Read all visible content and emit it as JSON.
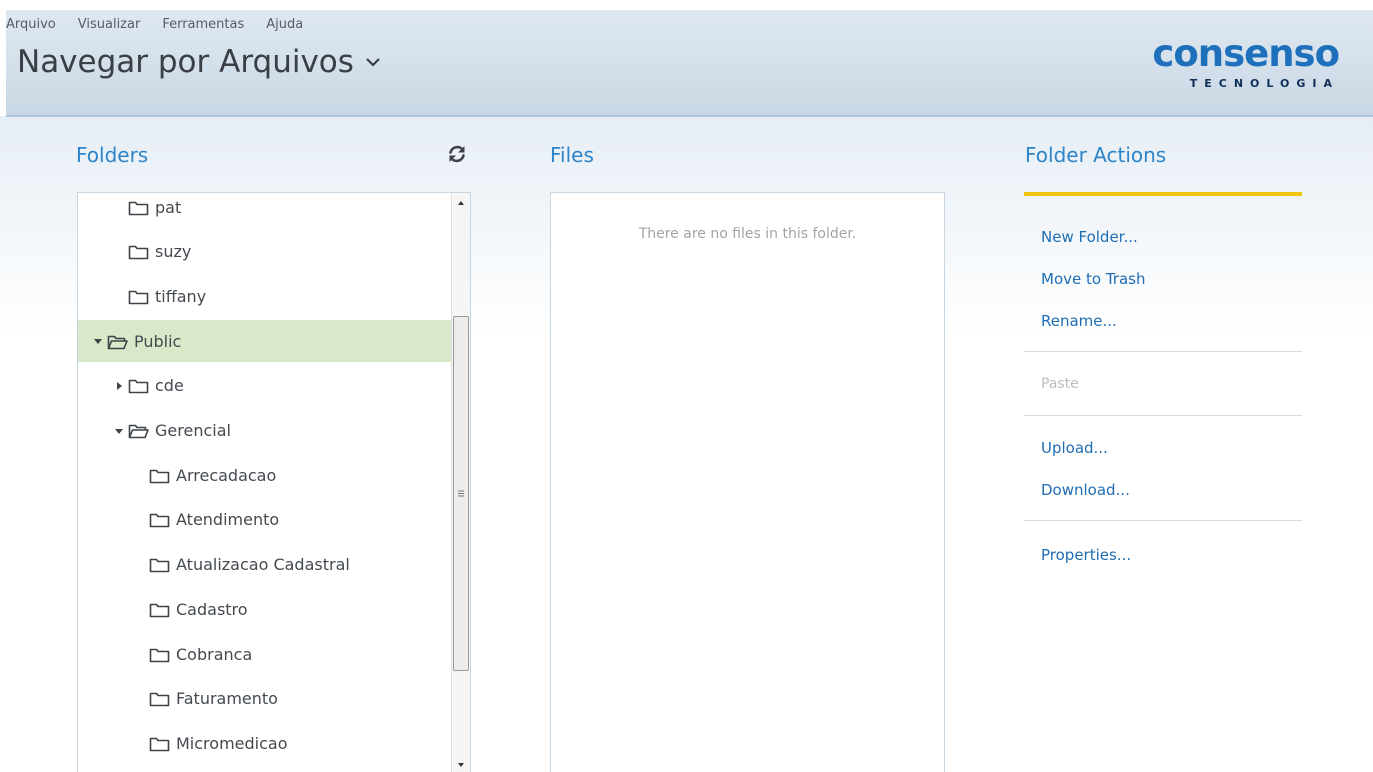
{
  "menu": [
    "Arquivo",
    "Visualizar",
    "Ferramentas",
    "Ajuda"
  ],
  "app_title": "Navegar por Arquivos",
  "logo": {
    "word": "consenso",
    "sub": "TECNOLOGIA",
    "color": "#1e70bd"
  },
  "folders": {
    "title": "Folders",
    "refresh_icon": "refresh-icon",
    "items": [
      {
        "label": "pat",
        "state": "leaf",
        "depth": 1
      },
      {
        "label": "suzy",
        "state": "leaf",
        "depth": 1
      },
      {
        "label": "tiffany",
        "state": "leaf",
        "depth": 1
      },
      {
        "label": "Public",
        "state": "expanded",
        "depth": 0,
        "selected": true
      },
      {
        "label": "cde",
        "state": "collapsed",
        "depth": 1
      },
      {
        "label": "Gerencial",
        "state": "expanded",
        "depth": 1
      },
      {
        "label": "Arrecadacao",
        "state": "leaf",
        "depth": 2
      },
      {
        "label": "Atendimento",
        "state": "leaf",
        "depth": 2
      },
      {
        "label": "Atualizacao Cadastral",
        "state": "leaf",
        "depth": 2
      },
      {
        "label": "Cadastro",
        "state": "leaf",
        "depth": 2
      },
      {
        "label": "Cobranca",
        "state": "leaf",
        "depth": 2
      },
      {
        "label": "Faturamento",
        "state": "leaf",
        "depth": 2
      },
      {
        "label": "Micromedicao",
        "state": "leaf",
        "depth": 2
      }
    ],
    "selected_color": "#d8e8c8"
  },
  "files": {
    "title": "Files",
    "empty_message": "There are no files in this folder."
  },
  "folder_actions": {
    "title": "Folder Actions",
    "accent_color": "#f1c40f",
    "new_folder": "New Folder...",
    "move_to_trash": "Move to Trash",
    "rename": "Rename...",
    "paste": "Paste",
    "upload": "Upload...",
    "download": "Download...",
    "properties": "Properties..."
  }
}
